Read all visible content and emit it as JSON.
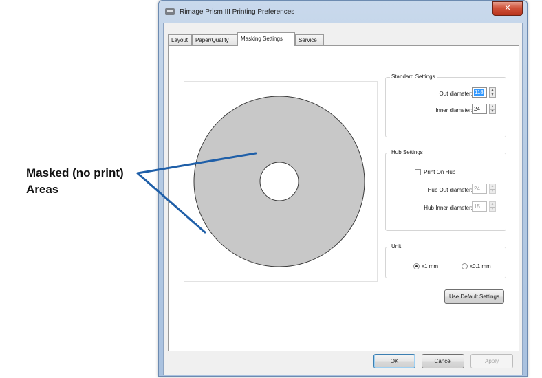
{
  "window": {
    "title": "Rimage Prism III Printing Preferences",
    "close_glyph": "✕"
  },
  "tabs": [
    {
      "label": "Layout",
      "active": false
    },
    {
      "label": "Paper/Quality",
      "active": false
    },
    {
      "label": "Masking Settings",
      "active": true
    },
    {
      "label": "Service",
      "active": false
    }
  ],
  "standard_settings": {
    "title": "Standard Settings",
    "out_diameter_label": "Out diameter:",
    "out_diameter_value": "118",
    "inner_diameter_label": "Inner diameter:",
    "inner_diameter_value": "24"
  },
  "hub_settings": {
    "title": "Hub Settings",
    "print_on_hub_label": "Print On Hub",
    "print_on_hub_checked": false,
    "hub_out_diameter_label": "Hub Out diameter:",
    "hub_out_diameter_value": "24",
    "hub_inner_diameter_label": "Hub Inner diameter:",
    "hub_inner_diameter_value": "15"
  },
  "unit": {
    "title": "Unit",
    "option_1mm": "x1 mm",
    "option_01mm": "x0.1 mm",
    "selected": "x1 mm"
  },
  "buttons": {
    "use_default": "Use Default Settings",
    "ok": "OK",
    "cancel": "Cancel",
    "apply": "Apply"
  },
  "callout": {
    "line1": "Masked (no print)",
    "line2": "Areas"
  },
  "colors": {
    "disc_fill": "#c8c8c8",
    "callout_line": "#1f5fa8",
    "close_button": "#c8452c"
  },
  "icons": {
    "app_icon": "printer-icon",
    "spin_up": "▲",
    "spin_down": "▼"
  }
}
